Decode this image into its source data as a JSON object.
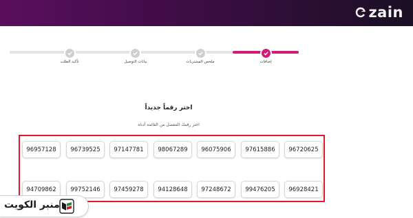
{
  "header": {
    "brand": "zain",
    "colors": {
      "gradient_start": "#5a0e5e",
      "gradient_end": "#1a0f24",
      "accent": "#d11a7a"
    }
  },
  "stepper": {
    "steps": [
      {
        "label": "تأكيد الطلب",
        "state": "pending"
      },
      {
        "label": "بيانات التوصيل",
        "state": "pending"
      },
      {
        "label": "ملخص المشتريات",
        "state": "pending"
      },
      {
        "label": "إضافات",
        "state": "active"
      }
    ]
  },
  "main": {
    "title": "اختر رقماً جديداً",
    "subtitle": "اختر رقمك المفضل من القائمة أدناه"
  },
  "numbers": {
    "row1": [
      "96957128",
      "96739525",
      "97147781",
      "98067289",
      "96075906",
      "97615886",
      "96720625"
    ],
    "row2": [
      "94709862",
      "99752146",
      "97459278",
      "94128648",
      "97248672",
      "99476205",
      "96928421"
    ]
  },
  "watermark": {
    "text": "منبر الكويت"
  }
}
